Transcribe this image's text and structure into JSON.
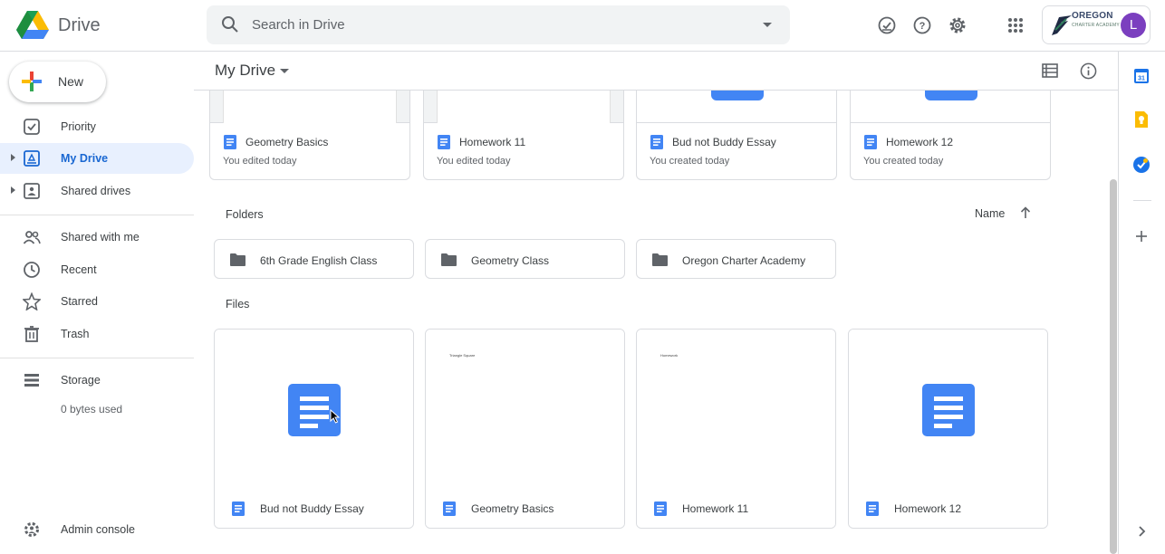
{
  "app": {
    "name": "Drive"
  },
  "search": {
    "placeholder": "Search in Drive"
  },
  "account": {
    "avatar_letter": "L",
    "avatar_color": "#7b3fbf",
    "org_name_line1": "OREGON",
    "org_name_line2": "CHARTER ACADEMY"
  },
  "header_icons": [
    "ready-for-offline-icon",
    "help-icon",
    "settings-icon",
    "apps-grid-icon"
  ],
  "sidebar": {
    "new_label": "New",
    "items": [
      {
        "label": "Priority",
        "icon": "priority-icon"
      },
      {
        "label": "My Drive",
        "icon": "my-drive-icon",
        "active": true
      },
      {
        "label": "Shared drives",
        "icon": "shared-drives-icon"
      },
      {
        "label": "Shared with me",
        "icon": "shared-with-me-icon"
      },
      {
        "label": "Recent",
        "icon": "clock-icon"
      },
      {
        "label": "Starred",
        "icon": "star-icon"
      },
      {
        "label": "Trash",
        "icon": "trash-icon"
      }
    ],
    "storage_label": "Storage",
    "storage_used": "0 bytes used",
    "admin_label": "Admin console"
  },
  "main": {
    "title": "My Drive",
    "quick_access": [
      {
        "name": "Geometry Basics",
        "sub": "You edited today"
      },
      {
        "name": "Homework 11",
        "sub": "You edited today"
      },
      {
        "name": "Bud not Buddy Essay",
        "sub": "You created today"
      },
      {
        "name": "Homework 12",
        "sub": "You created today"
      }
    ],
    "folders_label": "Folders",
    "sort_label": "Name",
    "folders": [
      "6th Grade English Class",
      "Geometry Class",
      "Oregon Charter Academy"
    ],
    "files_label": "Files",
    "files": [
      {
        "name": "Bud not Buddy Essay"
      },
      {
        "name": "Geometry Basics",
        "preview_text": "Triangle Square"
      },
      {
        "name": "Homework 11",
        "preview_text": "Homework"
      },
      {
        "name": "Homework 12"
      }
    ]
  },
  "colors": {
    "accent": "#1a73e8",
    "active_bg": "#e8f0fe",
    "doc_blue": "#4285f4"
  }
}
